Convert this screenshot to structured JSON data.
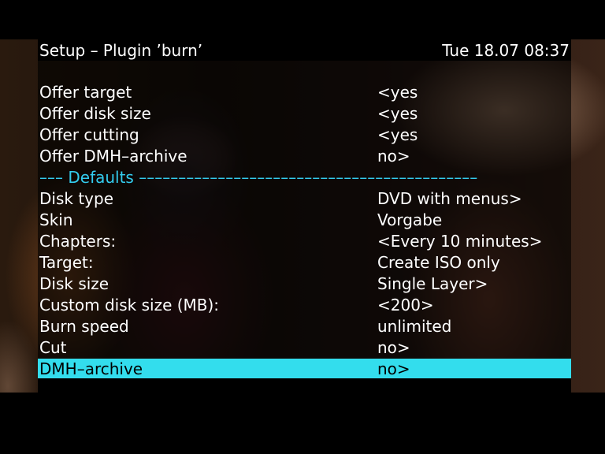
{
  "header": {
    "title": "Setup – Plugin ’burn’",
    "datetime": "Tue 18.07 08:37"
  },
  "menu": {
    "items": [
      {
        "label": "Offer target",
        "value": "<yes"
      },
      {
        "label": "Offer disk size",
        "value": "<yes"
      },
      {
        "label": "Offer cutting",
        "value": "<yes"
      },
      {
        "label": "Offer DMH–archive",
        "value": "no>"
      },
      {
        "label": "––– Defaults –––––––––––––––––––––––––––––––––––––––––––",
        "value": ""
      },
      {
        "label": "Disk type",
        "value": "DVD with menus>"
      },
      {
        "label": "Skin",
        "value": "Vorgabe"
      },
      {
        "label": "Chapters:",
        "value": "<Every 10 minutes>"
      },
      {
        "label": "Target:",
        "value": "Create ISO only"
      },
      {
        "label": "Disk size",
        "value": "Single Layer>"
      },
      {
        "label": "Custom disk size (MB):",
        "value": "<200>"
      },
      {
        "label": "Burn speed",
        "value": "unlimited"
      },
      {
        "label": "Cut",
        "value": "no>"
      },
      {
        "label": "DMH–archive",
        "value": "no>"
      }
    ],
    "selected_index": 13
  },
  "colors": {
    "highlight": "#33dded",
    "separator_text": "#33ccee",
    "text": "#ffffff"
  }
}
